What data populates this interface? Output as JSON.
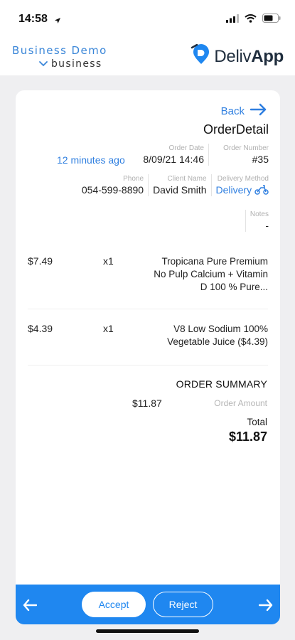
{
  "status_bar": {
    "time": "14:58",
    "icons": [
      "location-arrow-icon",
      "signal-icon",
      "wifi-icon",
      "battery-icon"
    ]
  },
  "header": {
    "business_name": "Business Demo",
    "business_switch_label": "business",
    "logo_text_light": "Deliv",
    "logo_text_bold": "App"
  },
  "order": {
    "back_label": "Back",
    "title": "OrderDetail",
    "time_ago": "12 minutes ago",
    "order_date_label": "Order Date",
    "order_date": "8/09/21 14:46",
    "order_number_label": "Order Number",
    "order_number": "#35",
    "phone_label": "Phone",
    "phone": "054-599-8890",
    "client_name_label": "Client Name",
    "client_name": "David Smith",
    "delivery_method_label": "Delivery Method",
    "delivery_method": "Delivery",
    "notes_label": "Notes",
    "notes": "-"
  },
  "items": [
    {
      "price": "$7.49",
      "qty": "x1",
      "name": "Tropicana Pure Premium No Pulp Calcium + Vitamin D 100 % Pure..."
    },
    {
      "price": "$4.39",
      "qty": "x1",
      "name": "V8 Low Sodium 100% Vegetable Juice ($4.39)"
    }
  ],
  "summary": {
    "title": "ORDER SUMMARY",
    "amount": "$11.87",
    "amount_label": "Order Amount",
    "total_label": "Total",
    "total": "$11.87"
  },
  "actions": {
    "accept_label": "Accept",
    "reject_label": "Reject"
  },
  "colors": {
    "accent": "#1f87f0",
    "link": "#2f7fe0",
    "background": "#efeff1"
  }
}
